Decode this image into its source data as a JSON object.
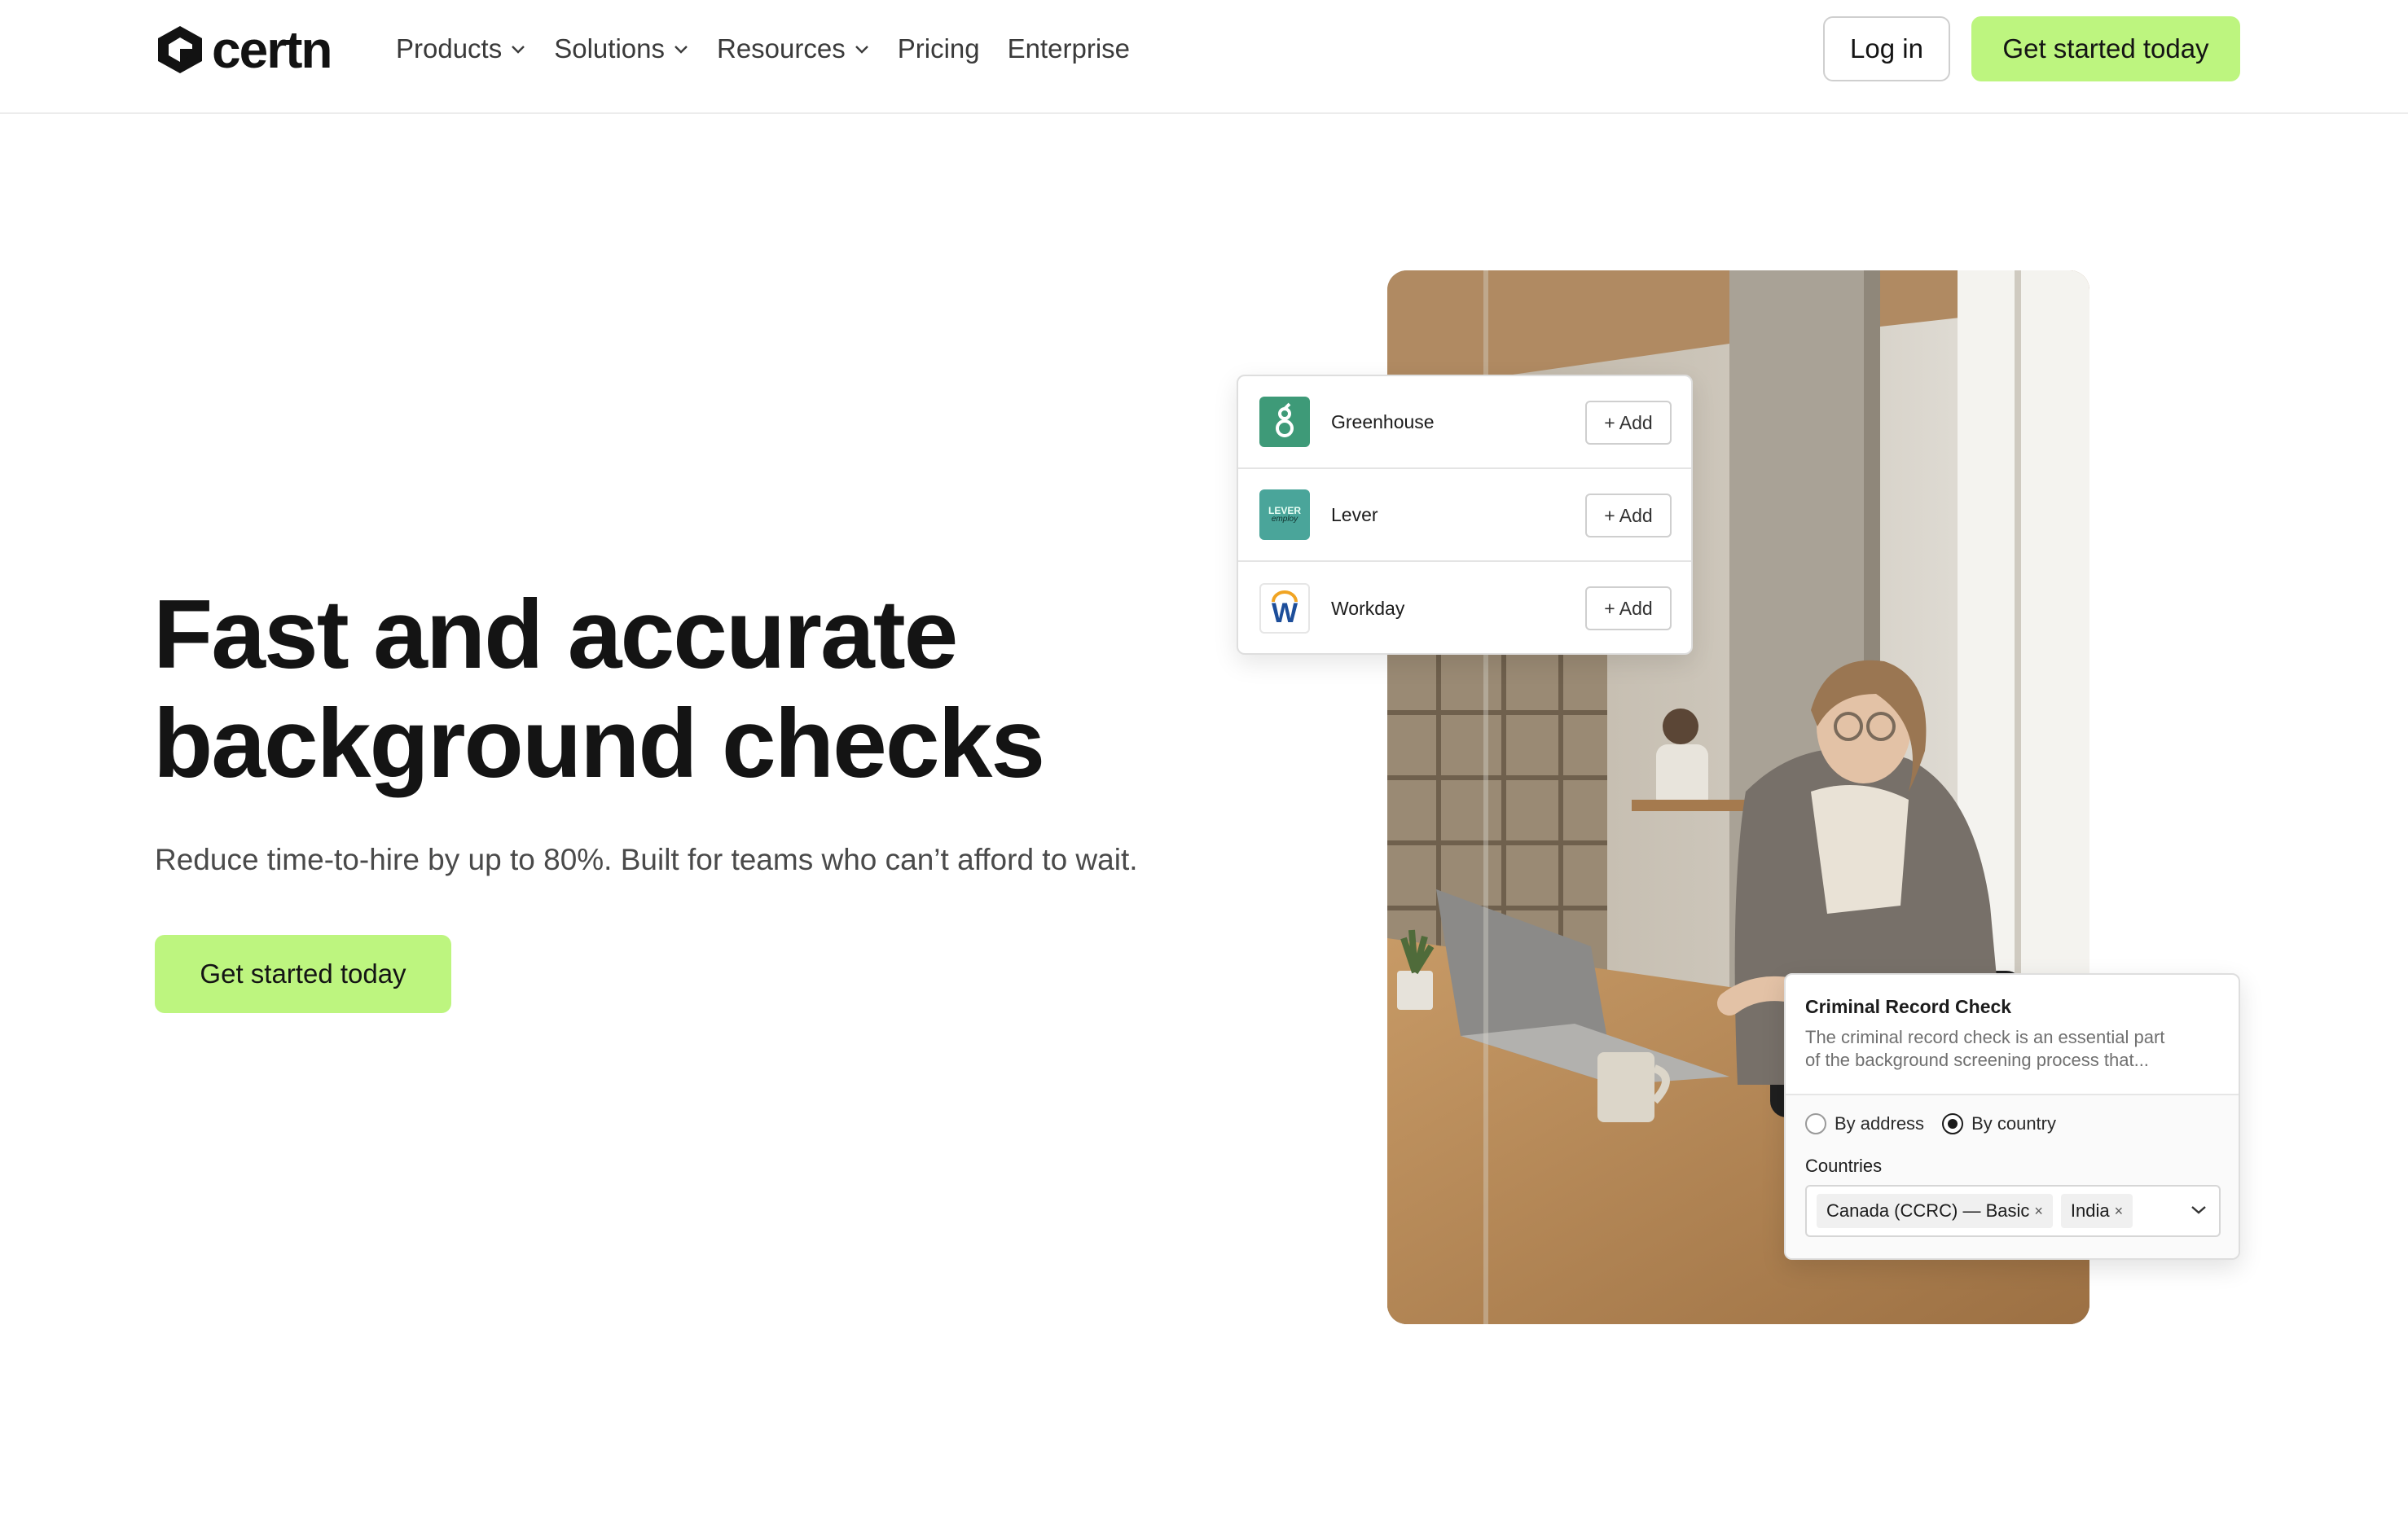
{
  "brand": {
    "name": "certn",
    "accent": "#bdf57f"
  },
  "nav": {
    "items": [
      {
        "label": "Products",
        "has_dropdown": true
      },
      {
        "label": "Solutions",
        "has_dropdown": true
      },
      {
        "label": "Resources",
        "has_dropdown": true
      },
      {
        "label": "Pricing",
        "has_dropdown": false
      },
      {
        "label": "Enterprise",
        "has_dropdown": false
      }
    ],
    "login_label": "Log in",
    "cta_label": "Get started today"
  },
  "hero": {
    "title_line1": "Fast and accurate",
    "title_line2": "background checks",
    "subtitle": "Reduce time-to-hire by up to 80%. Built for teams who can’t afford to wait.",
    "cta_label": "Get started today"
  },
  "integrations": {
    "add_label": "+ Add",
    "items": [
      {
        "name": "Greenhouse",
        "icon": "greenhouse-logo"
      },
      {
        "name": "Lever",
        "icon": "lever-logo",
        "logo_text_top": "LEVER",
        "logo_text_bottom": "employ"
      },
      {
        "name": "Workday",
        "icon": "workday-logo",
        "logo_letter": "W"
      }
    ]
  },
  "criminal_check": {
    "title": "Criminal Record Check",
    "description_line1": "The criminal record check is an essential part",
    "description_line2": "of the background screening process that...",
    "options": [
      {
        "label": "By address",
        "selected": false
      },
      {
        "label": "By country",
        "selected": true
      }
    ],
    "countries_label": "Countries",
    "selected_countries": [
      "Canada (CCRC) — Basic",
      "India"
    ]
  }
}
